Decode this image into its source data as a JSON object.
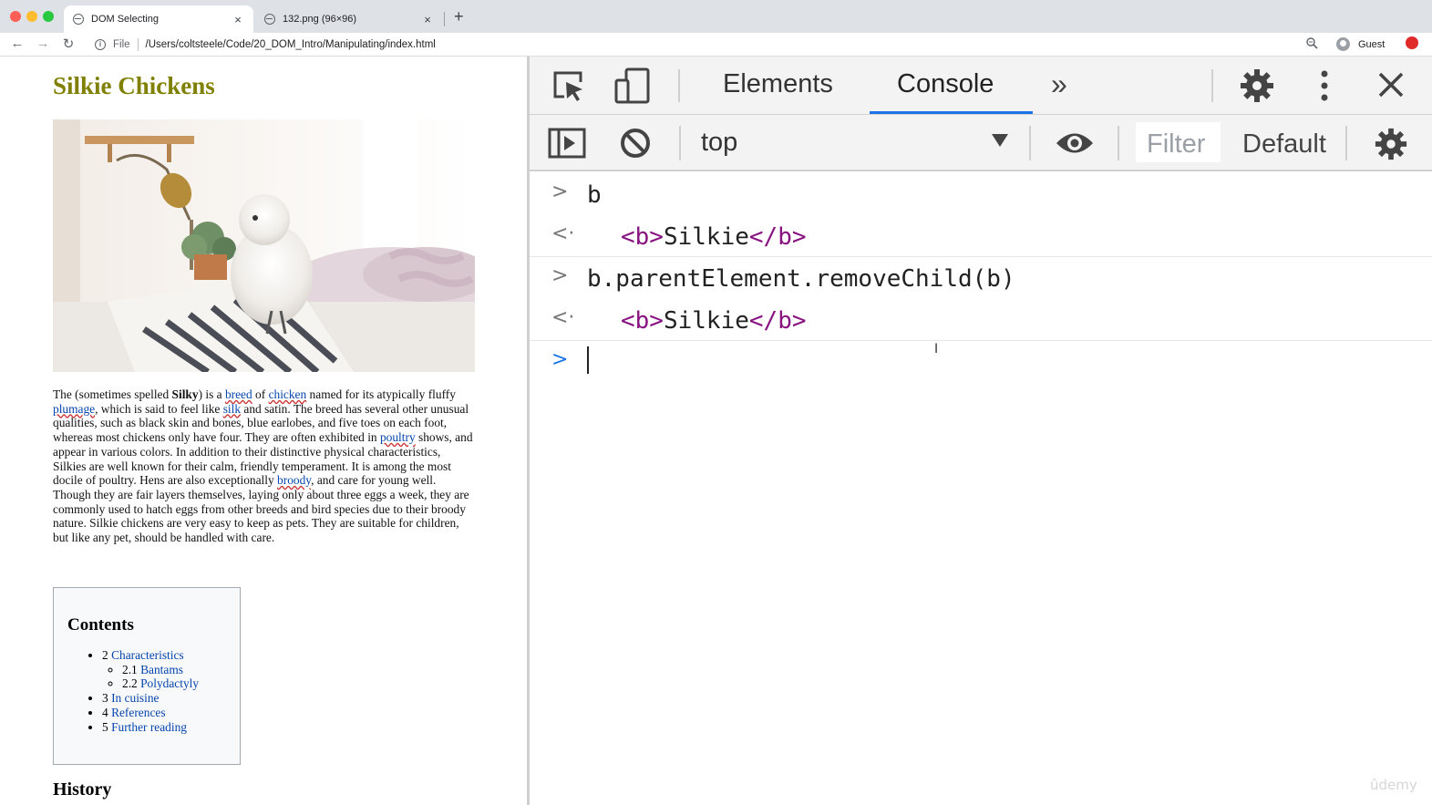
{
  "browser": {
    "tabs": [
      {
        "title": "DOM Selecting",
        "active": true
      },
      {
        "title": "132.png (96×96)",
        "active": false
      }
    ],
    "close_glyph": "×",
    "new_tab_glyph": "+",
    "nav": {
      "back": "←",
      "forward": "→",
      "reload": "↻"
    },
    "address": {
      "scheme": "File",
      "path": "/Users/coltsteele/Code/20_DOM_Intro/Manipulating/index.html"
    },
    "profile_label": "Guest"
  },
  "page": {
    "title": "Silkie Chickens",
    "image_alt": "White silkie chicken sitting on a striped pillow",
    "paragraph": {
      "t1": "The (sometimes spelled ",
      "bold": "Silky",
      "t2": ") is a ",
      "link_breed": "breed",
      "t3": " of ",
      "link_chicken": "chicken",
      "t4": " named for its atypically fluffy ",
      "link_plumage": "plumage",
      "t5": ", which is said to feel like ",
      "link_silk": "silk",
      "t6": " and satin. The breed has several other unusual qualities, such as black skin and bones, blue earlobes, and five toes on each foot, whereas most chickens only have four. They are often exhibited in ",
      "link_poultry": "poultry",
      "t7": " shows, and appear in various colors. In addition to their distinctive physical characteristics, Silkies are well known for their calm, friendly temperament. It is among the most docile of poultry. Hens are also exceptionally ",
      "link_broody": "broody",
      "t8": ", and care for young well. Though they are fair layers themselves, laying only about three eggs a week, they are commonly used to hatch eggs from other breeds and bird species due to their broody nature. Silkie chickens are very easy to keep as pets. They are suitable for children, but like any pet, should be handled with care."
    },
    "toc": {
      "title": "Contents",
      "items": [
        {
          "num": "2",
          "label": "Characteristics"
        },
        {
          "num": "2.1",
          "label": "Bantams"
        },
        {
          "num": "2.2",
          "label": "Polydactyly"
        },
        {
          "num": "3",
          "label": "In cuisine"
        },
        {
          "num": "4",
          "label": "References"
        },
        {
          "num": "5",
          "label": "Further reading"
        }
      ]
    },
    "section_heading": "History"
  },
  "devtools": {
    "tabs": {
      "elements": "Elements",
      "console": "Console",
      "more": "»"
    },
    "close_glyph": "✕",
    "context": "top",
    "filter_placeholder": "Filter",
    "levels": "Default levels",
    "active_color": "#1a73e8",
    "tag_color": "#881280",
    "console": [
      {
        "type": "input",
        "prompt": ">",
        "text": "b"
      },
      {
        "type": "output",
        "prompt": "<·",
        "open_tag": "<b>",
        "content": "Silkie",
        "close_tag": "</b>"
      },
      {
        "type": "input",
        "prompt": ">",
        "text": "b.parentElement.removeChild(b)"
      },
      {
        "type": "output",
        "prompt": "<·",
        "open_tag": "<b>",
        "content": "Silkie",
        "close_tag": "</b>"
      },
      {
        "type": "prompt",
        "prompt": ">"
      }
    ]
  },
  "watermark": "ûdemy",
  "icons": [
    "inspect-element-icon",
    "device-toggle-icon",
    "settings-gear-icon",
    "kebab-menu-icon",
    "close-icon",
    "sidebar-toggle-icon",
    "clear-console-icon",
    "dropdown-arrow-icon",
    "live-expression-eye-icon",
    "console-settings-gear-icon",
    "zoom-icon",
    "info-icon"
  ]
}
